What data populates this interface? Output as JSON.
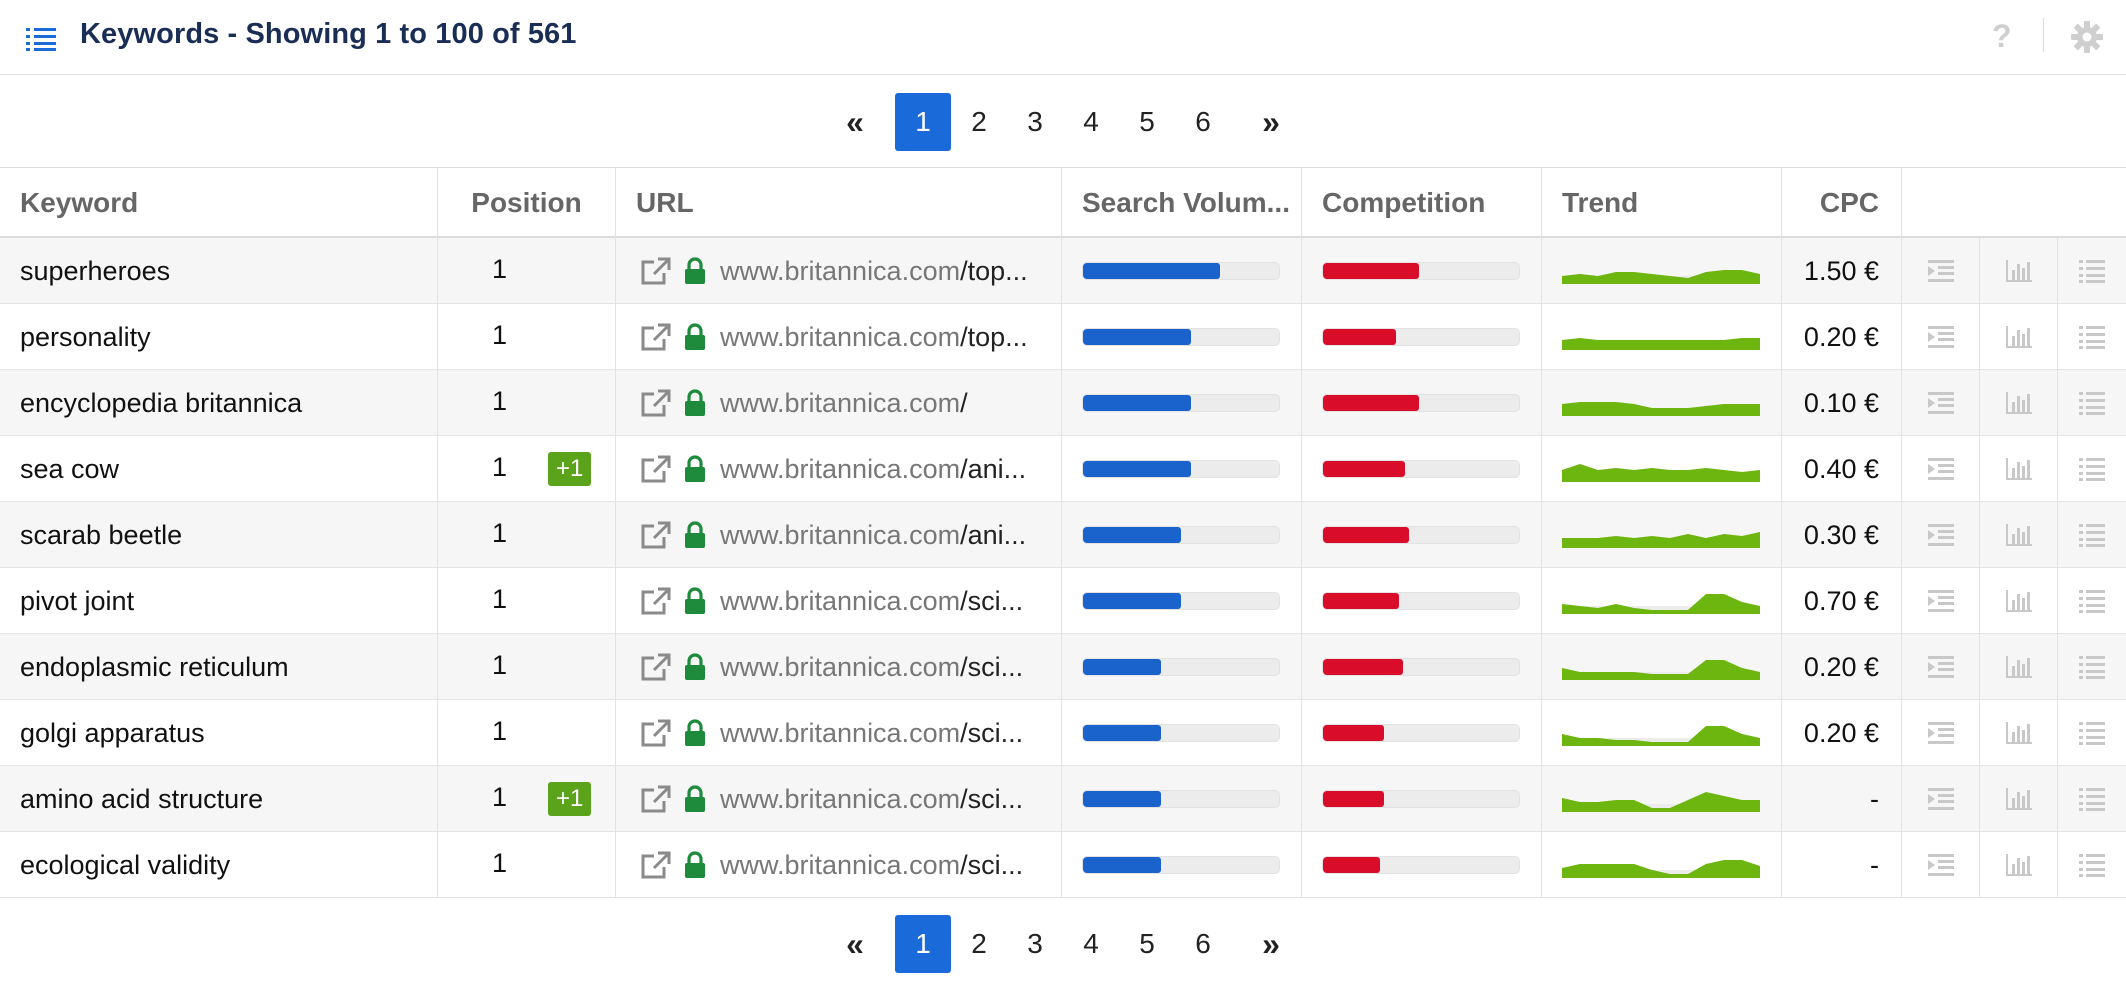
{
  "header": {
    "title": "Keywords - Showing 1 to 100 of 561",
    "list_icon": "list-icon",
    "help_label": "?",
    "settings_icon": "gear-icon"
  },
  "pagination": {
    "first_label": "«",
    "last_label": "»",
    "pages": [
      "1",
      "2",
      "3",
      "4",
      "5",
      "6"
    ],
    "active_page": "1"
  },
  "columns": {
    "keyword": "Keyword",
    "position": "Position",
    "url": "URL",
    "search_volume": "Search Volum...",
    "competition": "Competition",
    "trend": "Trend",
    "cpc": "CPC"
  },
  "colors": {
    "accent": "#1a6ad9",
    "search_volume_bar": "#1a62cc",
    "competition_bar": "#d90d2a",
    "trend_fill": "#6db50f",
    "badge_green": "#5ba31b",
    "lock_green": "#1d8a3c"
  },
  "rows": [
    {
      "keyword": "superheroes",
      "position": "1",
      "change": "",
      "url_host": "www.britannica.com",
      "url_path": "/top...",
      "search_volume": 0.7,
      "competition": 0.49,
      "cpc": "1.50 €",
      "trend": [
        0.3,
        0.4,
        0.3,
        0.5,
        0.5,
        0.4,
        0.3,
        0.2,
        0.5,
        0.6,
        0.6,
        0.4
      ]
    },
    {
      "keyword": "personality",
      "position": "1",
      "change": "",
      "url_host": "www.britannica.com",
      "url_path": "/top...",
      "search_volume": 0.55,
      "competition": 0.37,
      "cpc": "0.20 €",
      "trend": [
        0.4,
        0.5,
        0.4,
        0.4,
        0.4,
        0.4,
        0.4,
        0.4,
        0.4,
        0.4,
        0.5,
        0.5
      ]
    },
    {
      "keyword": "encyclopedia britannica",
      "position": "1",
      "change": "",
      "url_host": "www.britannica.com",
      "url_path": "/",
      "search_volume": 0.55,
      "competition": 0.49,
      "cpc": "0.10 €",
      "trend": [
        0.5,
        0.6,
        0.6,
        0.6,
        0.5,
        0.3,
        0.3,
        0.3,
        0.4,
        0.5,
        0.5,
        0.5
      ]
    },
    {
      "keyword": "sea cow",
      "position": "1",
      "change": "+1",
      "url_host": "www.britannica.com",
      "url_path": "/ani...",
      "search_volume": 0.55,
      "competition": 0.42,
      "cpc": "0.40 €",
      "trend": [
        0.5,
        0.8,
        0.5,
        0.6,
        0.5,
        0.6,
        0.5,
        0.5,
        0.6,
        0.5,
        0.4,
        0.5
      ]
    },
    {
      "keyword": "scarab beetle",
      "position": "1",
      "change": "",
      "url_host": "www.britannica.com",
      "url_path": "/ani...",
      "search_volume": 0.5,
      "competition": 0.44,
      "cpc": "0.30 €",
      "trend": [
        0.4,
        0.4,
        0.4,
        0.5,
        0.4,
        0.5,
        0.4,
        0.6,
        0.4,
        0.6,
        0.5,
        0.7
      ]
    },
    {
      "keyword": "pivot joint",
      "position": "1",
      "change": "",
      "url_host": "www.britannica.com",
      "url_path": "/sci...",
      "search_volume": 0.5,
      "competition": 0.39,
      "cpc": "0.70 €",
      "trend": [
        0.4,
        0.3,
        0.2,
        0.4,
        0.2,
        0.1,
        0.1,
        0.1,
        0.9,
        0.9,
        0.5,
        0.3
      ]
    },
    {
      "keyword": "endoplasmic reticulum",
      "position": "1",
      "change": "",
      "url_host": "www.britannica.com",
      "url_path": "/sci...",
      "search_volume": 0.4,
      "competition": 0.41,
      "cpc": "0.20 €",
      "trend": [
        0.5,
        0.3,
        0.3,
        0.3,
        0.3,
        0.2,
        0.2,
        0.2,
        0.9,
        0.9,
        0.5,
        0.3
      ]
    },
    {
      "keyword": "golgi apparatus",
      "position": "1",
      "change": "",
      "url_host": "www.britannica.com",
      "url_path": "/sci...",
      "search_volume": 0.4,
      "competition": 0.31,
      "cpc": "0.20 €",
      "trend": [
        0.5,
        0.3,
        0.3,
        0.2,
        0.2,
        0.1,
        0.1,
        0.1,
        0.9,
        0.9,
        0.5,
        0.3
      ]
    },
    {
      "keyword": "amino acid structure",
      "position": "1",
      "change": "+1",
      "url_host": "www.britannica.com",
      "url_path": "/sci...",
      "search_volume": 0.4,
      "competition": 0.31,
      "cpc": "-",
      "trend": [
        0.6,
        0.4,
        0.4,
        0.5,
        0.5,
        0.1,
        0.1,
        0.5,
        0.9,
        0.7,
        0.5,
        0.5
      ]
    },
    {
      "keyword": "ecological validity",
      "position": "1",
      "change": "",
      "url_host": "www.britannica.com",
      "url_path": "/sci...",
      "search_volume": 0.4,
      "competition": 0.29,
      "cpc": "-",
      "trend": [
        0.4,
        0.6,
        0.6,
        0.6,
        0.6,
        0.3,
        0.1,
        0.1,
        0.6,
        0.8,
        0.8,
        0.5
      ]
    }
  ],
  "row_actions": [
    "serp-snippet-icon",
    "chart-icon",
    "list-details-icon"
  ]
}
